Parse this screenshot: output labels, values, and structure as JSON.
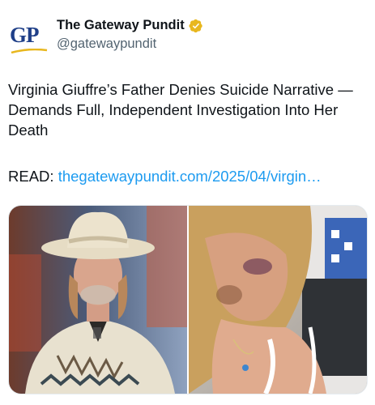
{
  "account": {
    "avatar_text": "GP",
    "display_name": "The Gateway Pundit",
    "handle": "@gatewaypundit",
    "verified": true,
    "verified_badge_color": "#e8b71e"
  },
  "tweet": {
    "text": "Virginia Giuffre’s Father Denies Suicide Narrative — Demands Full, Independent Investigation Into Her Death",
    "read_prefix": "READ: ",
    "link_text": "thegatewaypundit.com/2025/04/virgin…"
  },
  "media": {
    "images": [
      {
        "name": "man-in-cowboy-hat-photo"
      },
      {
        "name": "bruised-woman-hospital-photo"
      }
    ]
  },
  "colors": {
    "link": "#1d9bf0",
    "text": "#0f1419",
    "secondary_text": "#536471",
    "brand_blue": "#1f3f88",
    "brand_gold": "#e8b71e"
  }
}
